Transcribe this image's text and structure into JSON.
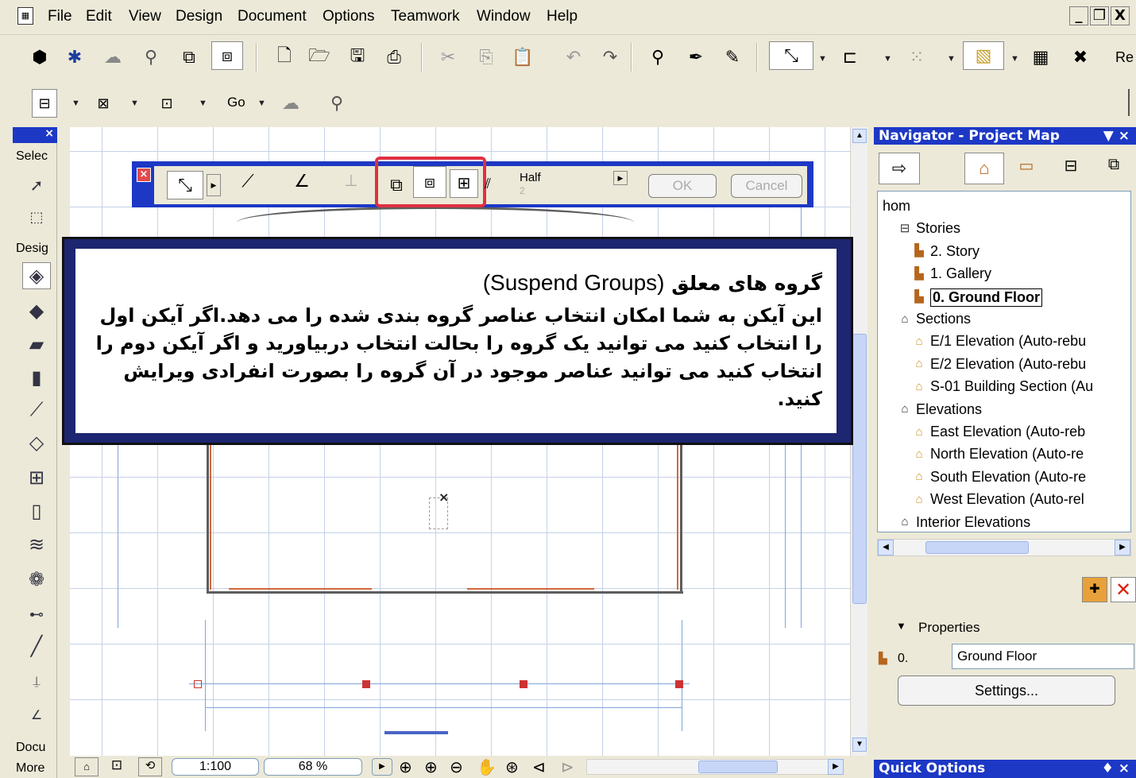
{
  "window": {
    "menu": [
      "File",
      "Edit",
      "View",
      "Design",
      "Document",
      "Options",
      "Teamwork",
      "Window",
      "Help"
    ],
    "controls": {
      "minimize": "_",
      "restore": "❐",
      "close": "X"
    }
  },
  "toolbar": {
    "right_label": "Re",
    "go_label": "Go"
  },
  "toolbox": {
    "close": "×",
    "select_label": "Selec",
    "design_label": "Desig",
    "document_label": "Docu",
    "more_label": "More"
  },
  "floating_bar": {
    "half_label": "Half",
    "half_sub": "2",
    "ok_label": "OK",
    "cancel_label": "Cancel"
  },
  "callout": {
    "title_fa": "گروه های معلق",
    "title_en": "(Suspend Groups)",
    "body": "این آیکن به شما امکان انتخاب عناصر گروه بندی شده را می دهد.اگر آیکن اول را انتخاب کنید می توانید یک گروه را بحالت انتخاب دربیاورید و اگر آیکن دوم را انتخاب کنید می توانید عناصر موجود در آن گروه را بصورت انفرادی ویرایش کنید."
  },
  "statusbar": {
    "scale": "1:100",
    "zoom": "68 %"
  },
  "navigator": {
    "title": "Navigator - Project Map",
    "title_controls": "▼ ×",
    "tree": [
      {
        "label": "hom",
        "level": 0,
        "icon": ""
      },
      {
        "label": "Stories",
        "level": 1,
        "icon": "story-group"
      },
      {
        "label": "2. Story",
        "level": 2,
        "icon": "story"
      },
      {
        "label": "1. Gallery",
        "level": 2,
        "icon": "story"
      },
      {
        "label": "0. Ground Floor",
        "level": 2,
        "icon": "story",
        "selected": true
      },
      {
        "label": "Sections",
        "level": 1,
        "icon": "group"
      },
      {
        "label": "E/1 Elevation (Auto-rebu",
        "level": 2,
        "icon": "house"
      },
      {
        "label": "E/2 Elevation (Auto-rebu",
        "level": 2,
        "icon": "house"
      },
      {
        "label": "S-01 Building Section (Au",
        "level": 2,
        "icon": "house"
      },
      {
        "label": "Elevations",
        "level": 1,
        "icon": "group"
      },
      {
        "label": "East Elevation (Auto-reb",
        "level": 2,
        "icon": "house"
      },
      {
        "label": "North Elevation (Auto-re",
        "level": 2,
        "icon": "house"
      },
      {
        "label": "South Elevation (Auto-re",
        "level": 2,
        "icon": "house"
      },
      {
        "label": "West Elevation (Auto-rel",
        "level": 2,
        "icon": "house"
      },
      {
        "label": "Interior Elevations",
        "level": 1,
        "icon": "group"
      }
    ],
    "properties_label": "Properties",
    "prop_index": "0.",
    "prop_value": "Ground Floor",
    "settings_label": "Settings...",
    "quick_options_title": "Quick Options",
    "quick_options_controls": "♦ ×"
  },
  "colors": {
    "title_blue": "#1d38c5",
    "highlight_red": "#e03040",
    "callout_frame": "#1d2670"
  }
}
